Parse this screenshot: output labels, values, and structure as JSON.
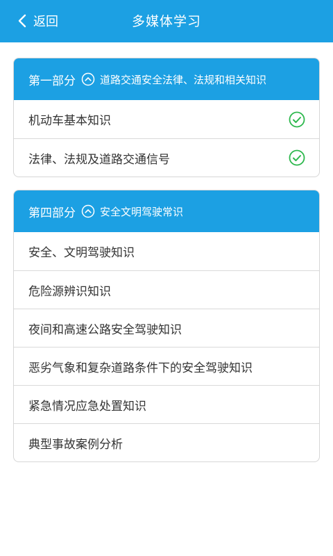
{
  "header": {
    "back_label": "返回",
    "title": "多媒体学习"
  },
  "colors": {
    "accent": "#1ca0e3",
    "check": "#2db84d"
  },
  "sections": [
    {
      "part": "第一部分",
      "subject": "道路交通安全法律、法规和相关知识",
      "items": [
        {
          "label": "机动车基本知识",
          "completed": true,
          "icon": "check-circle-icon"
        },
        {
          "label": "法律、法规及道路交通信号",
          "completed": true,
          "icon": "check-circle-icon"
        }
      ]
    },
    {
      "part": "第四部分",
      "subject": "安全文明驾驶常识",
      "items": [
        {
          "label": "安全、文明驾驶知识"
        },
        {
          "label": "危险源辨识知识"
        },
        {
          "label": "夜间和高速公路安全驾驶知识"
        },
        {
          "label": "恶劣气象和复杂道路条件下的安全驾驶知识"
        },
        {
          "label": "紧急情况应急处置知识"
        },
        {
          "label": "典型事故案例分析"
        }
      ]
    }
  ]
}
